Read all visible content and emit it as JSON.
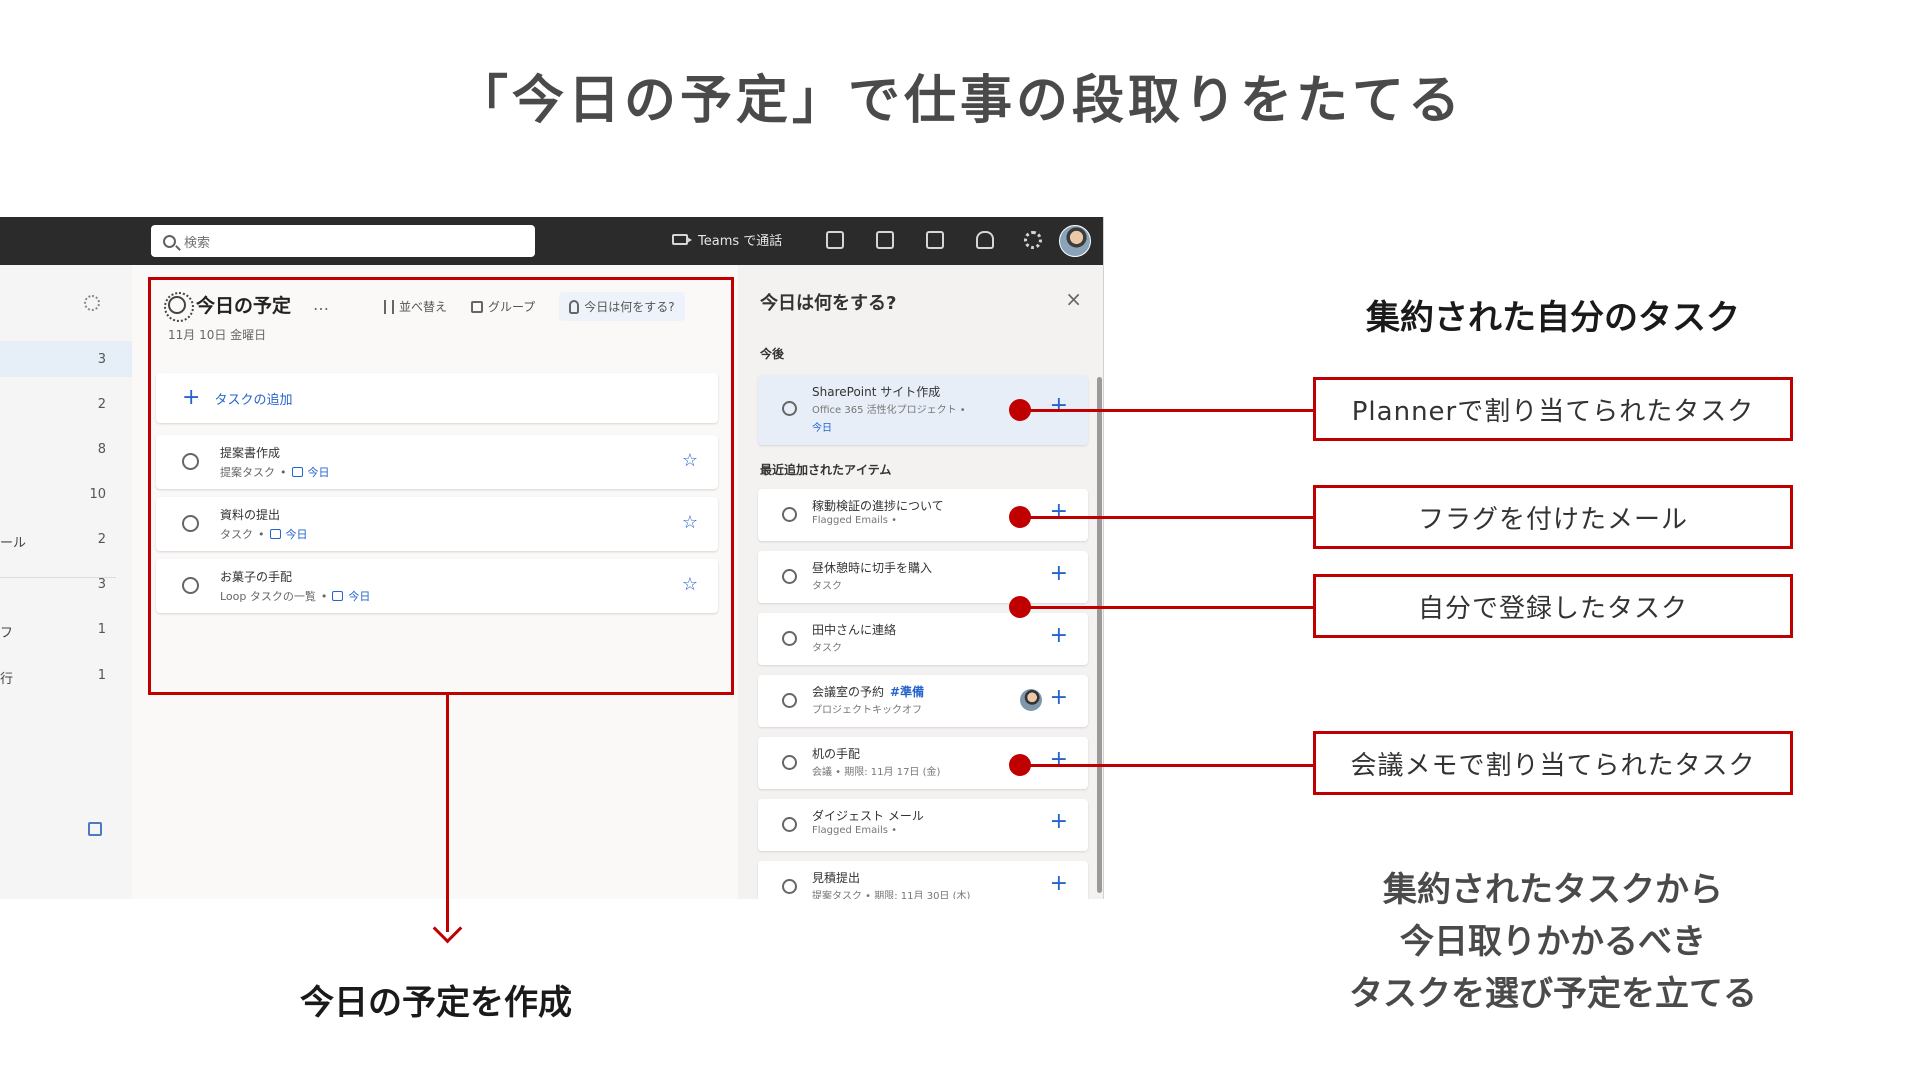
{
  "slide": {
    "title": "「今日の予定」で仕事の段取りをたてる",
    "caption_myday": "今日の予定を作成",
    "side_heading": "集約された自分のタスク",
    "side_description": [
      "集約されたタスクから",
      "今日取りかかるべき",
      "タスクを選び予定を立てる"
    ],
    "callouts": [
      "Plannerで割り当てられたタスク",
      "フラグを付けたメール",
      "自分で登録したタスク",
      "会議メモで割り当てられたタスク"
    ],
    "accent_color": "#c00000"
  },
  "app": {
    "topbar": {
      "search_placeholder": "検索",
      "teams_call_label": "Teams で通話",
      "icons": [
        "chat-icon",
        "office-icon",
        "sync-icon",
        "bell-icon",
        "gear-icon",
        "avatar"
      ]
    },
    "left_nav": {
      "counts": [
        "3",
        "2",
        "8",
        "10",
        "2",
        "3",
        "1",
        "1"
      ],
      "truncated_labels": [
        "ール",
        "フ",
        "行"
      ]
    },
    "myday": {
      "title": "今日の予定",
      "more": "…",
      "date": "11月 10日 金曜日",
      "actions": {
        "sort": "並べ替え",
        "group": "グループ",
        "suggestions": "今日は何をする?"
      },
      "add_task_label": "タスクの追加",
      "tasks": [
        {
          "name": "提案書作成",
          "list": "提案タスク",
          "due": "今日"
        },
        {
          "name": "資料の提出",
          "list": "タスク",
          "due": "今日"
        },
        {
          "name": "お菓子の手配",
          "list": "Loop タスクの一覧",
          "due": "今日"
        }
      ]
    },
    "suggestions": {
      "title": "今日は何をする?",
      "close": "×",
      "section_upcoming": "今後",
      "section_recent": "最近追加されたアイテム",
      "upcoming": [
        {
          "name": "SharePoint サイト作成",
          "sub": "Office 365 活性化プロジェクト •",
          "due": "今日"
        }
      ],
      "recent": [
        {
          "name": "稼動検証の進捗について",
          "sub": "Flagged Emails •"
        },
        {
          "name": "昼休憩時に切手を購入",
          "sub": "タスク"
        },
        {
          "name": "田中さんに連絡",
          "sub": "タスク"
        },
        {
          "name": "会議室の予約",
          "tag": "#準備",
          "sub": "プロジェクトキックオフ"
        },
        {
          "name": "机の手配",
          "sub": "会議 • 期限: 11月 17日 (金)"
        },
        {
          "name": "ダイジェスト メール",
          "sub": "Flagged Emails •"
        },
        {
          "name": "見積提出",
          "sub": "提案タスク • 期限: 11月 30日 (木)"
        }
      ]
    }
  }
}
